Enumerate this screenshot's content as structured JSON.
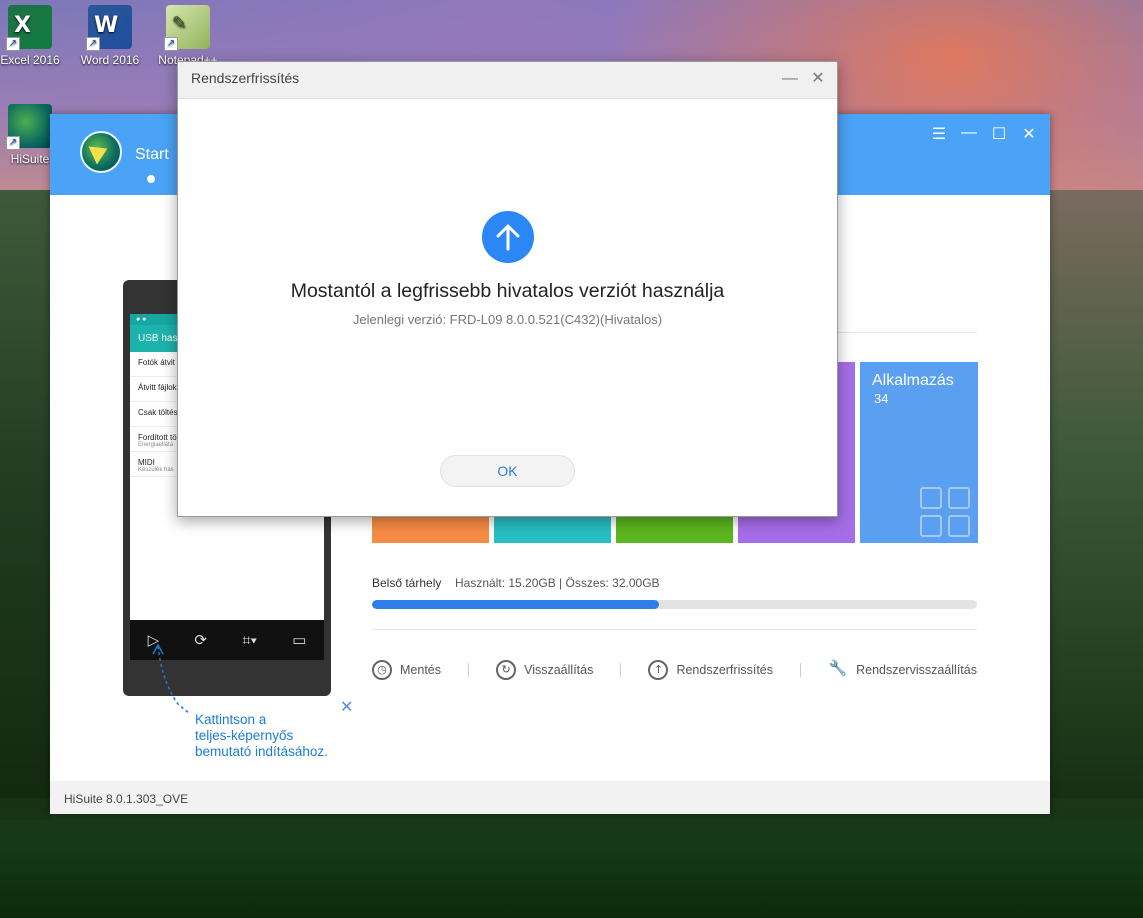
{
  "desktop": {
    "icons": [
      {
        "label": "Excel 2016",
        "glyph": "X"
      },
      {
        "label": "Word 2016",
        "glyph": "W"
      },
      {
        "label": "Notepad++",
        "glyph": "✎"
      },
      {
        "label": "HiSuite",
        "glyph": ""
      }
    ]
  },
  "hisuite": {
    "start_label": "Start",
    "controls": {
      "menu": "☰",
      "minimize": "—",
      "maximize": "☐",
      "close": "✕"
    },
    "phone": {
      "title": "USB hasz",
      "rows": [
        {
          "label": "Fotók átvit",
          "sub": ""
        },
        {
          "label": "Átvitt fájlok",
          "sub": ""
        },
        {
          "label": "Csak töltés",
          "sub": ""
        },
        {
          "label": "Fordított tö",
          "sub": "Energiaellátá"
        },
        {
          "label": "MIDI",
          "sub": "Készülék has"
        }
      ]
    },
    "callout": {
      "line1": "Kattintson a",
      "line2": "teljes-képernyős",
      "line3": "bemutató indításához.",
      "close": "✕"
    },
    "tiles": [
      {
        "label": "",
        "count": "",
        "color": "#f88c45"
      },
      {
        "label": "",
        "count": "",
        "color": "#28bfc3"
      },
      {
        "label": "",
        "count": "",
        "color": "#5bb61e"
      },
      {
        "label": "",
        "count": "",
        "color": "#a56ee8"
      },
      {
        "label": "Alkalmazás",
        "count": "34",
        "color": "#5a9ff0"
      }
    ],
    "storage": {
      "label": "Belső tárhely",
      "info": "Használt: 15.20GB | Összes: 32.00GB",
      "used_fraction": 0.475
    },
    "actions": [
      {
        "label": "Mentés",
        "icon": "backup-icon",
        "glyph": "◷"
      },
      {
        "label": "Visszaállítás",
        "icon": "restore-icon",
        "glyph": "↻"
      },
      {
        "label": "Rendszerfrissítés",
        "icon": "update-icon",
        "glyph": "↑"
      },
      {
        "label": "Rendszervisszaállítás",
        "icon": "wrench-icon",
        "glyph": "🔧"
      }
    ],
    "footer": "HiSuite 8.0.1.303_OVE"
  },
  "dialog": {
    "title": "Rendszerfrissítés",
    "minimize": "—",
    "close": "✕",
    "heading": "Mostantól a legfrissebb hivatalos verziót használja",
    "version": "Jelenlegi verzió: FRD-L09 8.0.0.521(C432)(Hivatalos)",
    "ok_label": "OK"
  },
  "colors": {
    "accent": "#4aa3f7",
    "dialog_icon": "#2b87f5",
    "storage_fill": "#2e7de8"
  }
}
